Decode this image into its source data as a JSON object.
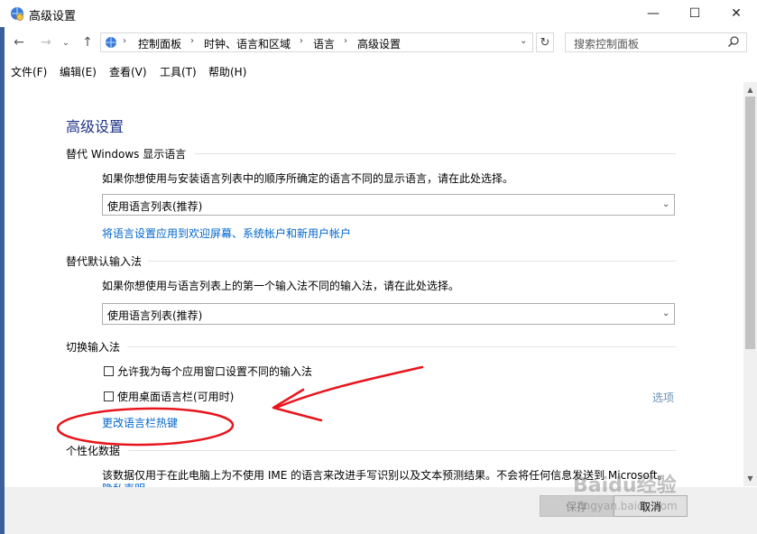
{
  "window": {
    "title": "高级设置",
    "minimize": "—",
    "maximize": "☐",
    "close": "✕"
  },
  "nav": {
    "back": "←",
    "forward": "→",
    "recent": "⌄",
    "up": "↑",
    "breadcrumbs": [
      "控制面板",
      "时钟、语言和区域",
      "语言",
      "高级设置"
    ],
    "separator": "›",
    "dropdown": "⌄",
    "refresh": "↻",
    "search_placeholder": "搜索控制面板"
  },
  "menu": [
    "文件(F)",
    "编辑(E)",
    "查看(V)",
    "工具(T)",
    "帮助(H)"
  ],
  "content": {
    "page_title": "高级设置",
    "section1": {
      "title": "替代 Windows 显示语言",
      "desc": "如果你想使用与安装语言列表中的顺序所确定的语言不同的显示语言，请在此处选择。",
      "dropdown_value": "使用语言列表(推荐)",
      "link": "将语言设置应用到欢迎屏幕、系统帐户和新用户帐户"
    },
    "section2": {
      "title": "替代默认输入法",
      "desc": "如果你想使用与语言列表上的第一个输入法不同的输入法，请在此处选择。",
      "dropdown_value": "使用语言列表(推荐)"
    },
    "section3": {
      "title": "切换输入法",
      "checkbox1": "允许我为每个应用窗口设置不同的输入法",
      "checkbox2": "使用桌面语言栏(可用时)",
      "options_link": "选项",
      "hotkey_link": "更改语言栏热键"
    },
    "section4": {
      "title": "个性化数据",
      "desc": "该数据仅用于在此电脑上为不使用 IME 的语言来改进手写识别以及文本预测结果。不会将任何信息发送到 Microsoft。",
      "link_partial": "隐私声明"
    }
  },
  "footer": {
    "save": "保存",
    "cancel": "取消"
  },
  "watermark": {
    "text1": "Baidu经验",
    "text2": "jingyan.baidu.com"
  },
  "colors": {
    "link": "#0066cc",
    "title": "#1e3287",
    "annotation": "#e8141c"
  }
}
